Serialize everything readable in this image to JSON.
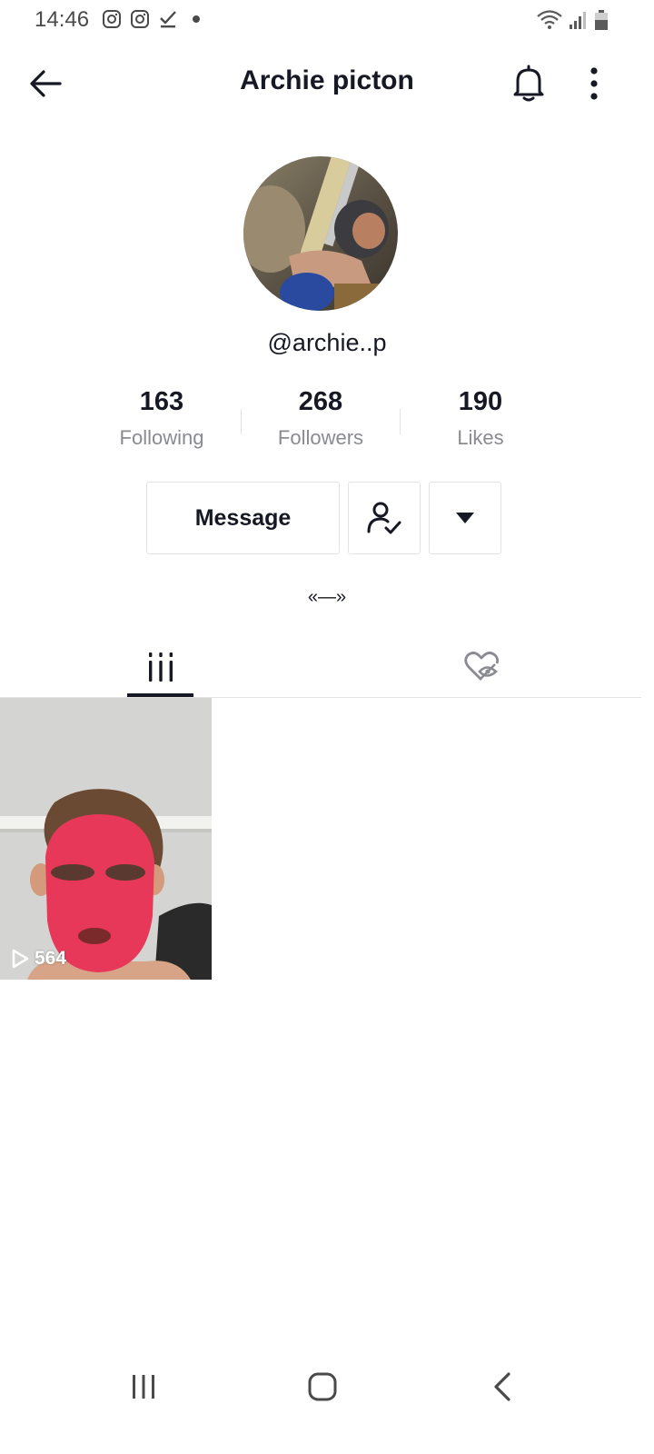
{
  "status_bar": {
    "time": "14:46",
    "left_icons": [
      "instagram-icon",
      "instagram-icon",
      "download-done-icon",
      "dot-icon"
    ],
    "right_icons": [
      "wifi-icon",
      "signal-icon",
      "battery-icon"
    ]
  },
  "header": {
    "title": "Archie picton",
    "back_icon": "arrow-left-icon",
    "bell_icon": "bell-icon",
    "more_icon": "more-vertical-icon"
  },
  "profile": {
    "username": "@archie..p",
    "bio": "«—»"
  },
  "stats": [
    {
      "value": "163",
      "label": "Following"
    },
    {
      "value": "268",
      "label": "Followers"
    },
    {
      "value": "190",
      "label": "Likes"
    }
  ],
  "actions": {
    "message_label": "Message",
    "friend_icon": "user-check-icon",
    "dropdown_icon": "caret-down-icon"
  },
  "tabs": {
    "videos_icon": "grid-bars-icon",
    "liked_icon": "heart-hidden-icon"
  },
  "videos": [
    {
      "views": "564"
    }
  ],
  "nav": {
    "recent_icon": "recent-apps-icon",
    "home_icon": "home-icon",
    "back_icon": "back-chevron-icon"
  },
  "colors": {
    "text_primary": "#161823",
    "text_secondary": "#8a8b91",
    "border": "#e3e3e4",
    "mask_pink": "#e8385a"
  }
}
